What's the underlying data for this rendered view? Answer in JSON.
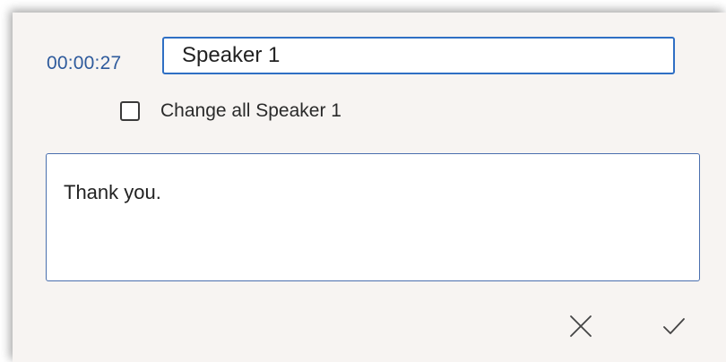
{
  "dialog": {
    "timestamp": "00:00:27",
    "speaker_name_value": "Speaker 1",
    "change_all_label": "Change all Speaker 1",
    "change_all_checked": false,
    "transcript_text": "Thank you.",
    "cancel_icon": "close-icon",
    "confirm_icon": "checkmark-icon"
  },
  "colors": {
    "accent": "#2f6fc4",
    "timestamp": "#2e5a9c",
    "panel_background": "#f7f4f2"
  }
}
